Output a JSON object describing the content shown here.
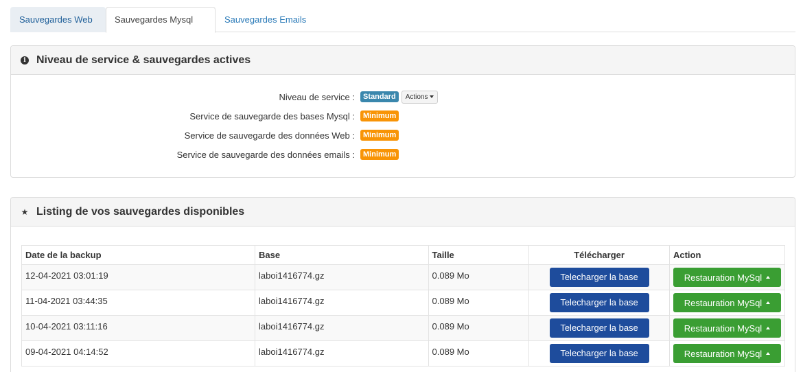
{
  "tabs": [
    {
      "label": "Sauvegardes Web"
    },
    {
      "label": "Sauvegardes Mysql"
    },
    {
      "label": "Sauvegardes Emails"
    }
  ],
  "service_panel": {
    "title": "Niveau de service & sauvegardes actives",
    "icon": "info-circle-icon",
    "rows": [
      {
        "label": "Niveau de service :",
        "badge": "Standard",
        "action_label": "Actions"
      },
      {
        "label": "Service de sauvegarde des bases Mysql :",
        "badge": "Minimum"
      },
      {
        "label": "Service de sauvegarde des données Web :",
        "badge": "Minimum"
      },
      {
        "label": "Service de sauvegarde des données emails :",
        "badge": "Minimum"
      }
    ],
    "colors": {
      "standard": "#3a87ad",
      "minimum": "#f89406"
    }
  },
  "backups_panel": {
    "title": "Listing de vos sauvegardes disponibles",
    "icon": "star-icon",
    "columns": [
      "Date de la backup",
      "Base",
      "Taille",
      "Télécharger",
      "Action"
    ],
    "download_label": "Telecharger la base",
    "restore_label": "Restauration MySql",
    "rows": [
      {
        "date": "12-04-2021 03:01:19",
        "base": "laboi1416774.gz",
        "size": "0.089 Mo"
      },
      {
        "date": "11-04-2021 03:44:35",
        "base": "laboi1416774.gz",
        "size": "0.089 Mo"
      },
      {
        "date": "10-04-2021 03:11:16",
        "base": "laboi1416774.gz",
        "size": "0.089 Mo"
      },
      {
        "date": "09-04-2021 04:14:52",
        "base": "laboi1416774.gz",
        "size": "0.089 Mo"
      }
    ],
    "colors": {
      "download": "#1e4c9c",
      "restore": "#3a9e33"
    }
  }
}
